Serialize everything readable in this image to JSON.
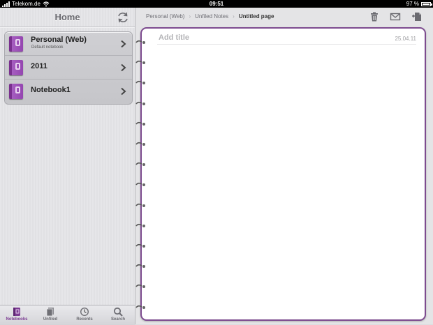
{
  "status_bar": {
    "carrier": "Telekom.de",
    "time": "09:51",
    "battery": "97 %",
    "battery_level": 0.97
  },
  "sidebar": {
    "title": "Home",
    "sync_icon": "sync-icon",
    "notebooks": [
      {
        "name": "Personal (Web)",
        "subtitle": "Default notebook"
      },
      {
        "name": "2011",
        "subtitle": ""
      },
      {
        "name": "Notebook1",
        "subtitle": ""
      }
    ]
  },
  "tabbar": {
    "tabs": [
      {
        "label": "Notebooks",
        "icon": "notebooks-icon",
        "active": true
      },
      {
        "label": "Unfiled",
        "icon": "unfiled-icon",
        "active": false
      },
      {
        "label": "Recents",
        "icon": "clock-icon",
        "active": false
      },
      {
        "label": "Search",
        "icon": "search-icon",
        "active": false
      }
    ]
  },
  "main": {
    "breadcrumb": [
      "Personal (Web)",
      "Unfiled Notes",
      "Untitled page"
    ],
    "toolbar_icons": [
      "trash-icon",
      "mail-icon",
      "new-page-icon"
    ],
    "page": {
      "title_placeholder": "Add title",
      "date": "25.04.11"
    }
  },
  "colors": {
    "accent": "#7b3a92",
    "page_border": "#7d4b8f"
  }
}
